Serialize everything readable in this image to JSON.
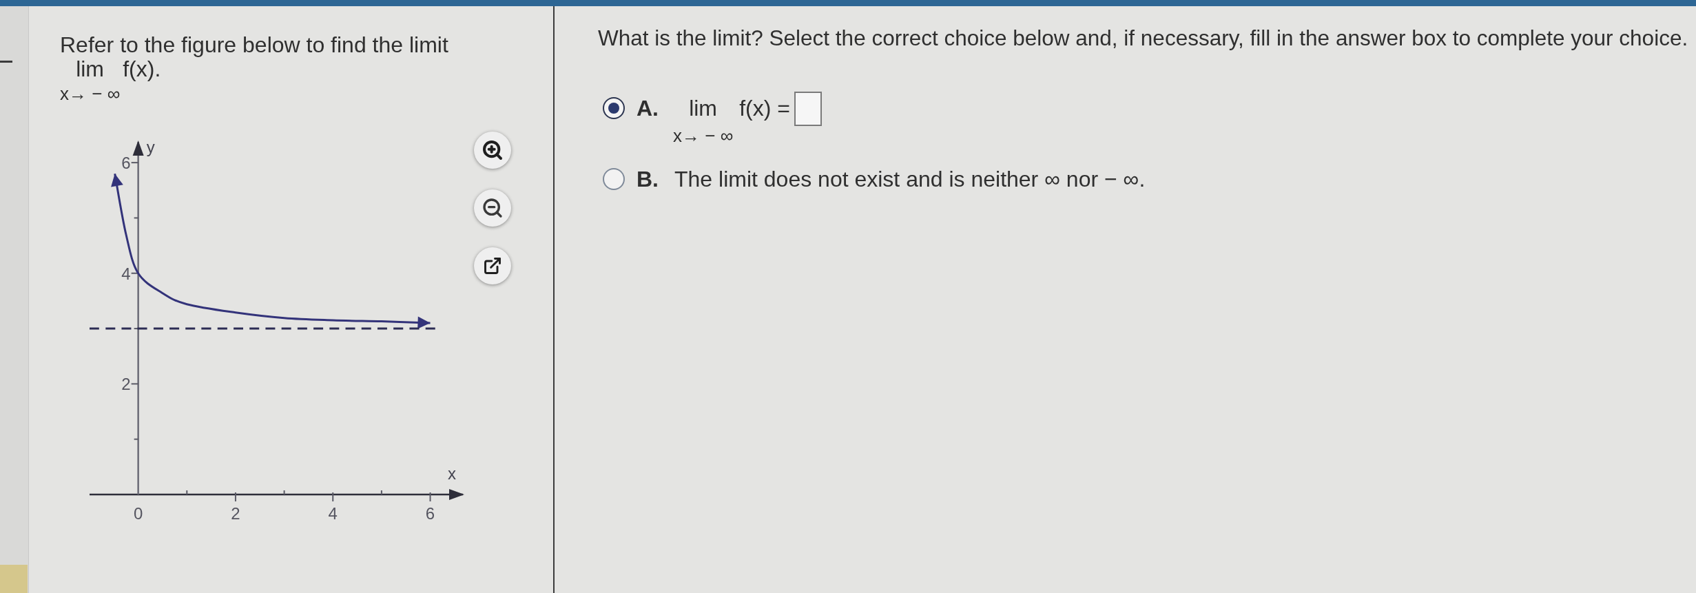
{
  "left_panel": {
    "prompt": "Refer to the figure below to find the limit",
    "limit": {
      "operator": "lim",
      "approach": "x→ − ∞",
      "expression": "f(x)."
    },
    "figure": {
      "chart_data": {
        "type": "line",
        "xlabel": "x",
        "ylabel": "y",
        "x": [
          -1,
          -0.48,
          -0.25,
          0,
          0.5,
          1,
          2,
          3,
          4,
          5,
          6,
          6.1
        ],
        "series": [
          {
            "color": "#33337a",
            "line_style": "solid",
            "values": [
              null,
              5.8,
              4.7,
              4,
              3.64,
              3.44,
              3.29,
              3.19,
              3.15,
              3.13,
              3.1,
              null
            ]
          },
          {
            "color": "#2c2c54",
            "line_style": "dashed",
            "values": [
              3,
              3,
              3,
              3,
              3,
              3,
              3,
              3,
              3,
              3,
              3,
              3
            ]
          }
        ],
        "xlim": [
          -1,
          6.7
        ],
        "ylim": [
          0,
          6.4
        ],
        "xticks": [
          0,
          2,
          4,
          6
        ],
        "yticks": [
          2,
          4,
          6
        ]
      }
    }
  },
  "right_panel": {
    "question": "What is the limit? Select the correct choice below and, if necessary, fill in the answer box to complete your choice.",
    "choices": [
      {
        "kind": "limit",
        "letter": "A.",
        "selected": true,
        "operator": "lim",
        "approach": "x→ − ∞",
        "expression": "f(x) ="
      },
      {
        "kind": "text",
        "letter": "B.",
        "selected": false,
        "text": "The limit does not exist and is neither ∞ nor − ∞."
      }
    ]
  }
}
